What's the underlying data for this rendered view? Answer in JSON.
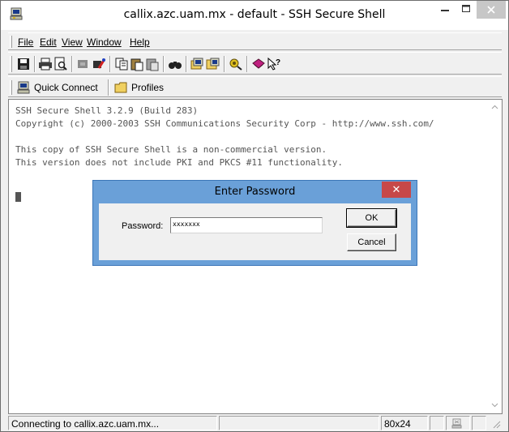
{
  "window": {
    "title": "callix.azc.uam.mx - default - SSH Secure Shell"
  },
  "menu": {
    "items": [
      "File",
      "Edit",
      "View",
      "Window",
      "Help"
    ]
  },
  "toolbar": {
    "icons": [
      "save-icon",
      "print-icon",
      "print-preview-icon",
      "disconnect-icon",
      "connect-icon",
      "copy-icon",
      "paste-icon",
      "paste-alt-icon",
      "find-icon",
      "file-transfer-icon",
      "settings-icon",
      "properties-icon",
      "help-book-icon",
      "context-help-icon"
    ]
  },
  "quickbar": {
    "quick_connect": "Quick Connect",
    "profiles": "Profiles"
  },
  "terminal": {
    "lines": [
      "SSH Secure Shell 3.2.9 (Build 283)",
      "Copyright (c) 2000-2003 SSH Communications Security Corp - http://www.ssh.com/",
      "",
      "This copy of SSH Secure Shell is a non-commercial version.",
      "This version does not include PKI and PKCS #11 functionality."
    ]
  },
  "status": {
    "message": "Connecting to callix.azc.uam.mx...",
    "size": "80x24"
  },
  "dialog": {
    "title": "Enter Password",
    "close_glyph": "✕",
    "password_label": "Password:",
    "password_value": "xxxxxxx",
    "ok": "OK",
    "cancel": "Cancel"
  },
  "colors": {
    "dialog_frame": "#6aa0d8",
    "close_button": "#c74848",
    "terminal_text": "#555555"
  }
}
